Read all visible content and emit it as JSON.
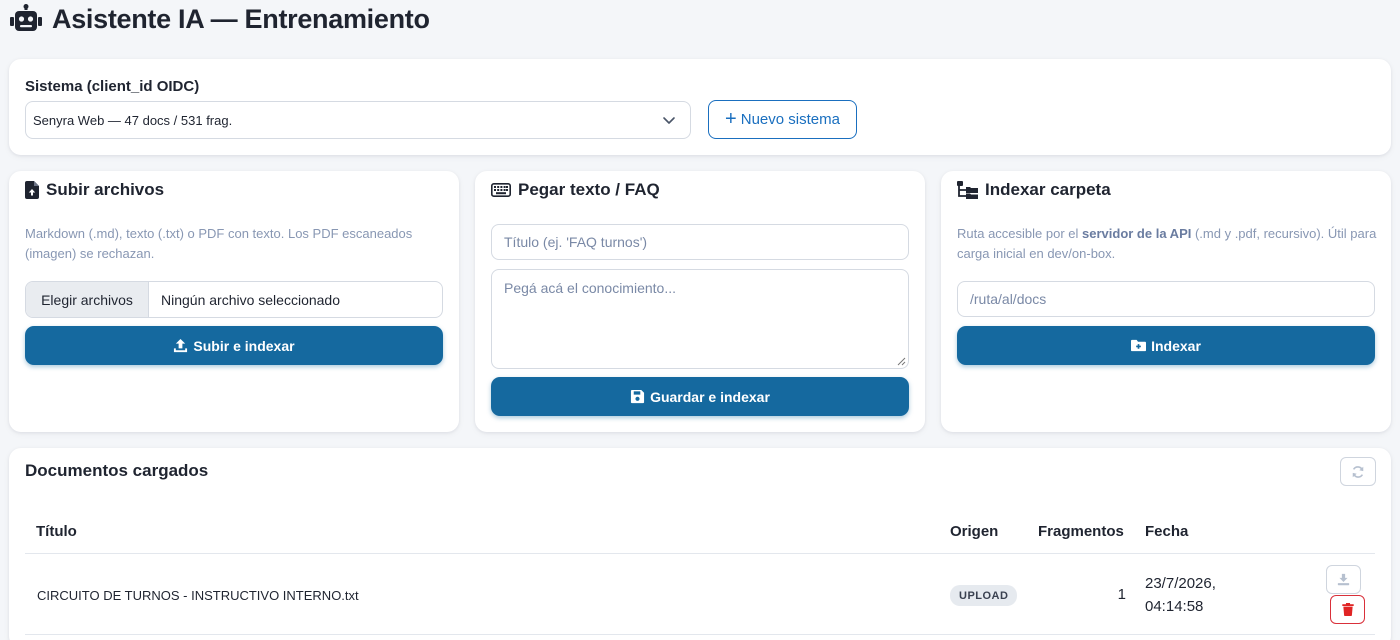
{
  "header": {
    "title": "Asistente IA — Entrenamiento",
    "icon": "robot-icon"
  },
  "system": {
    "label": "Sistema (client_id OIDC)",
    "selected": "Senyra Web — 47 docs / 531 frag.",
    "new_button": "Nuevo sistema"
  },
  "upload": {
    "title": "Subir archivos",
    "icon": "file-upload-icon",
    "help": "Markdown (.md), texto (.txt) o PDF con texto. Los PDF escaneados (imagen) se rechazan.",
    "choose_label": "Elegir archivos",
    "file_status": "Ningún archivo seleccionado",
    "button": "Subir e indexar"
  },
  "paste": {
    "title": "Pegar texto / FAQ",
    "icon": "keyboard-icon",
    "title_placeholder": "Título (ej. 'FAQ turnos')",
    "body_placeholder": "Pegá acá el conocimiento...",
    "button": "Guardar e indexar"
  },
  "folder": {
    "title": "Indexar carpeta",
    "icon": "folder-tree-icon",
    "help_pre": "Ruta accesible por el ",
    "help_bold": "servidor de la API",
    "help_post": " (.md y .pdf, recursivo). Útil para carga inicial en dev/on-box.",
    "path_placeholder": "/ruta/al/docs",
    "button": "Indexar"
  },
  "documents": {
    "title": "Documentos cargados",
    "columns": {
      "title": "Título",
      "origin": "Origen",
      "fragments": "Fragmentos",
      "date": "Fecha"
    },
    "rows": [
      {
        "title": "CIRCUITO DE TURNOS - INSTRUCTIVO INTERNO.txt",
        "origin": "UPLOAD",
        "fragments": "1",
        "date_line1": "23/7/2026,",
        "date_line2": "04:14:58"
      }
    ]
  },
  "colors": {
    "primary": "#15699f",
    "accent": "#1a6fbf",
    "danger": "#d9303a",
    "background": "#f4f6f9"
  }
}
